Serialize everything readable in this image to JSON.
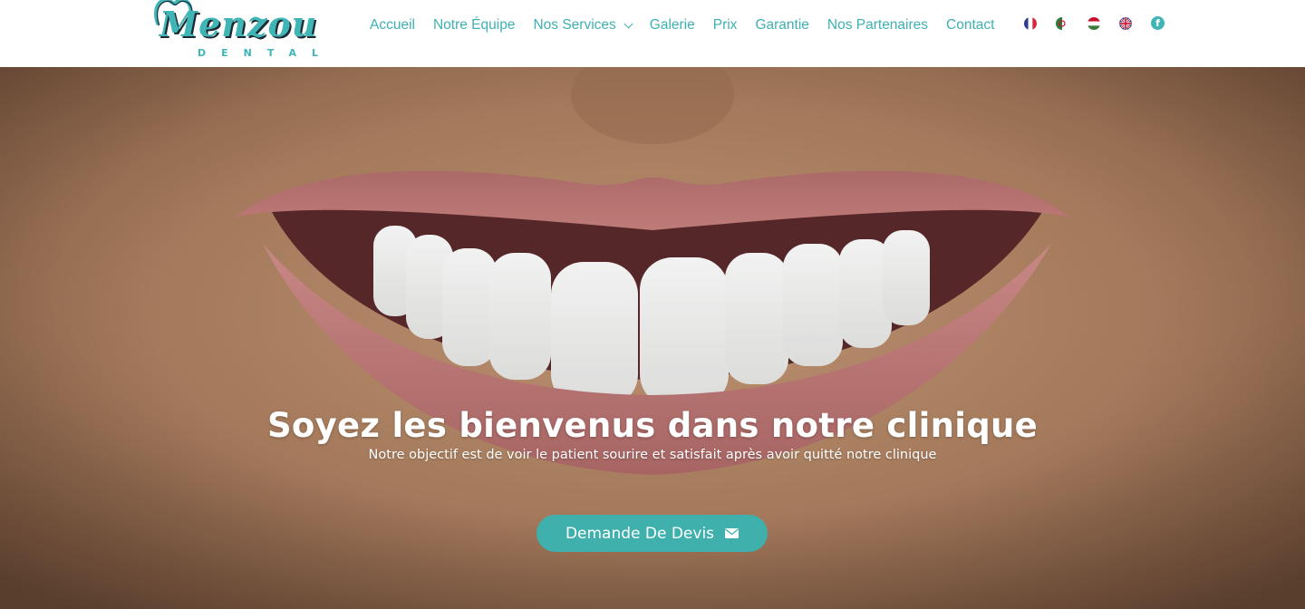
{
  "brand": {
    "logo_word": "Menzou",
    "logo_sub": "DENTAL",
    "accent_color": "#3fb0b2"
  },
  "nav": {
    "items": [
      {
        "label": "Accueil"
      },
      {
        "label": "Notre Équipe"
      },
      {
        "label": "Nos Services",
        "has_dropdown": true
      },
      {
        "label": "Galerie"
      },
      {
        "label": "Prix"
      },
      {
        "label": "Garantie"
      },
      {
        "label": "Nos Partenaires"
      },
      {
        "label": "Contact"
      }
    ],
    "languages": [
      {
        "icon": "france-flag-icon"
      },
      {
        "icon": "algeria-flag-icon"
      },
      {
        "icon": "hungary-flag-icon"
      },
      {
        "icon": "uk-flag-icon"
      }
    ],
    "social": {
      "icon": "facebook-icon",
      "glyph": "f"
    }
  },
  "hero": {
    "title": "Soyez les bienvenus dans notre clinique",
    "subtitle": "Notre objectif est de voir le patient sourire et satisfait après avoir quitté notre clinique",
    "cta_label": "Demande De Devis",
    "cta_icon": "envelope-icon",
    "cta_color": "#3fb0ac"
  }
}
